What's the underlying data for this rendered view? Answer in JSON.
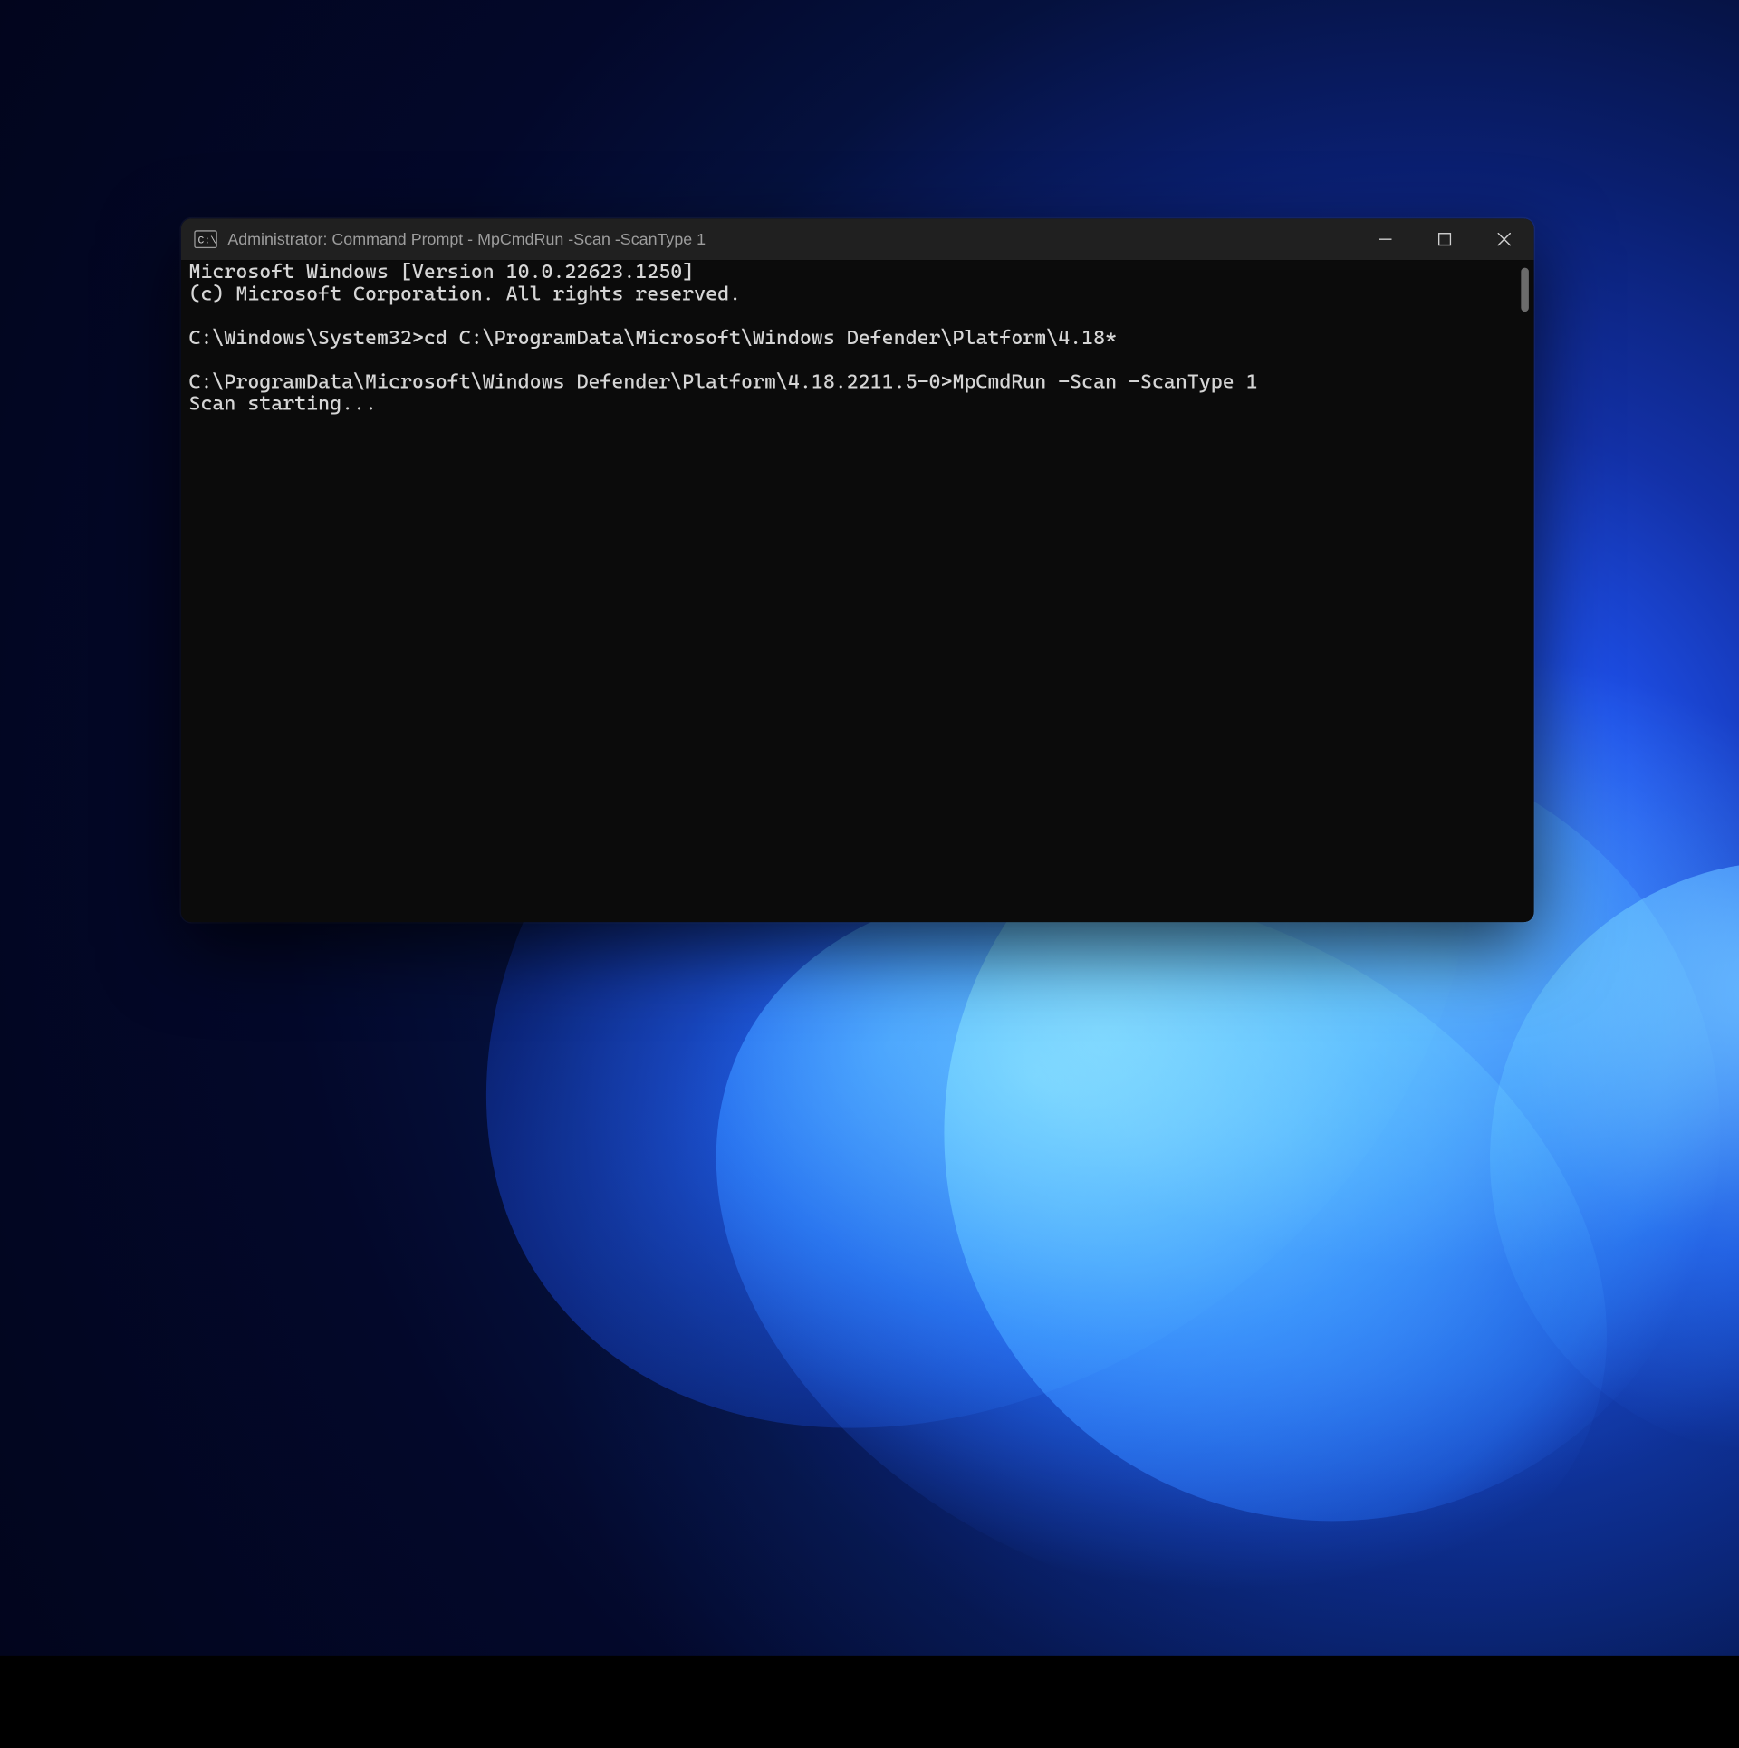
{
  "window": {
    "title": "Administrator: Command Prompt - MpCmdRun  -Scan -ScanType 1",
    "app_icon": "cmd-icon",
    "controls": {
      "minimize": "minimize-icon",
      "maximize": "maximize-icon",
      "close": "close-icon"
    }
  },
  "terminal": {
    "lines": [
      "Microsoft Windows [Version 10.0.22623.1250]",
      "(c) Microsoft Corporation. All rights reserved.",
      "",
      "C:\\Windows\\System32>cd C:\\ProgramData\\Microsoft\\Windows Defender\\Platform\\4.18*",
      "",
      "C:\\ProgramData\\Microsoft\\Windows Defender\\Platform\\4.18.2211.5-0>MpCmdRun -Scan -ScanType 1",
      "Scan starting..."
    ]
  }
}
